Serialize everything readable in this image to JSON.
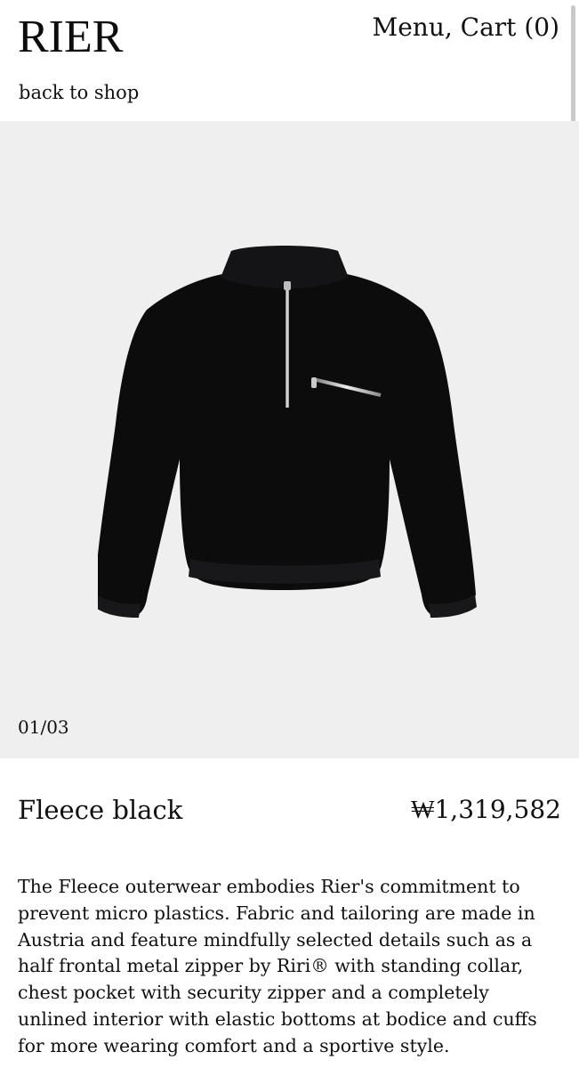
{
  "header": {
    "logo": "RIER",
    "menu_label": "Menu,",
    "cart_label": "Cart (0)",
    "back_link": "back to shop"
  },
  "gallery": {
    "counter": "01/03",
    "image_icon": "black-fleece-pullover-image",
    "background_color": "#efefef"
  },
  "product": {
    "title": "Fleece black",
    "price": "₩1,319,582",
    "description": "The Fleece outerwear embodies Rier's commitment to prevent micro plastics. Fabric and tailoring are made in Austria and feature mindfully selected details such as a half frontal metal zipper by Riri® with standing collar, chest pocket with security zipper and a completely unlined interior with elastic bottoms at bodice and cuffs for more wearing comfort and a sportive style."
  }
}
